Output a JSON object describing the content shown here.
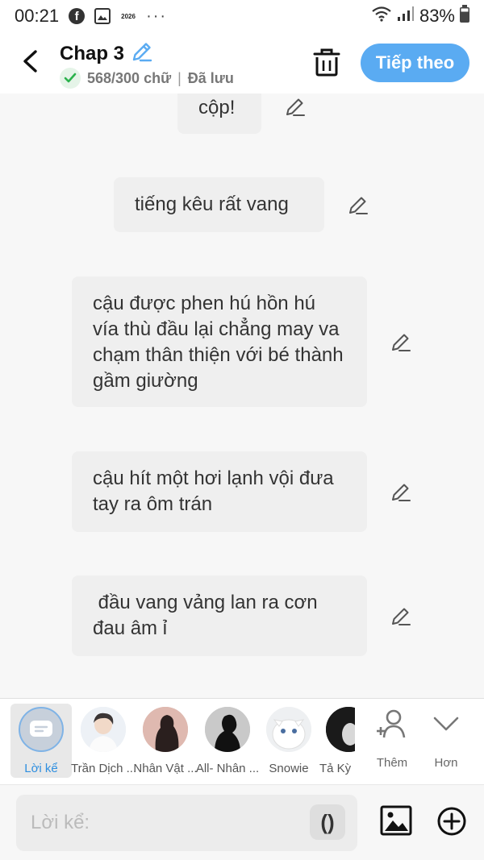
{
  "status_bar": {
    "time": "00:21",
    "icons": [
      "facebook-icon",
      "gallery-icon",
      "year-icon",
      "more-dots-icon",
      "wifi-icon",
      "signal-icon",
      "battery-icon"
    ],
    "year_badge": "2026",
    "battery": "83%"
  },
  "header": {
    "title": "Chap 3",
    "word_count": "568/300 chữ",
    "separator": "|",
    "saved_status": "Đã lưu",
    "next_label": "Tiếp theo"
  },
  "messages": [
    {
      "text": "cộp!"
    },
    {
      "text": "tiếng kêu rất vang"
    },
    {
      "text": "cậu được phen hú hồn hú vía thù đầu lại chẳng may va chạm thân thiện với bé thành gầm giường"
    },
    {
      "text": "cậu hít một hơi lạnh vội đưa tay ra ôm trán"
    },
    {
      "text": " đầu vang vảng lan ra cơn đau âm ỉ"
    }
  ],
  "characters": {
    "narrator_label": "Lời kể",
    "items": [
      {
        "label": "Trần Dịch ..."
      },
      {
        "label": "Nhân Vật ..."
      },
      {
        "label": "All- Nhân ..."
      },
      {
        "label": "Snowie"
      },
      {
        "label": "Tả Kỳ"
      }
    ],
    "add_label": "Thêm",
    "more_label": "Hơn"
  },
  "composer": {
    "placeholder": "Lời kể:",
    "paren_label": "()"
  },
  "colors": {
    "accent": "#5aabf2",
    "bubble": "#efefef",
    "background": "#f7f7f7",
    "narrator_active": "#2f8fe0"
  }
}
